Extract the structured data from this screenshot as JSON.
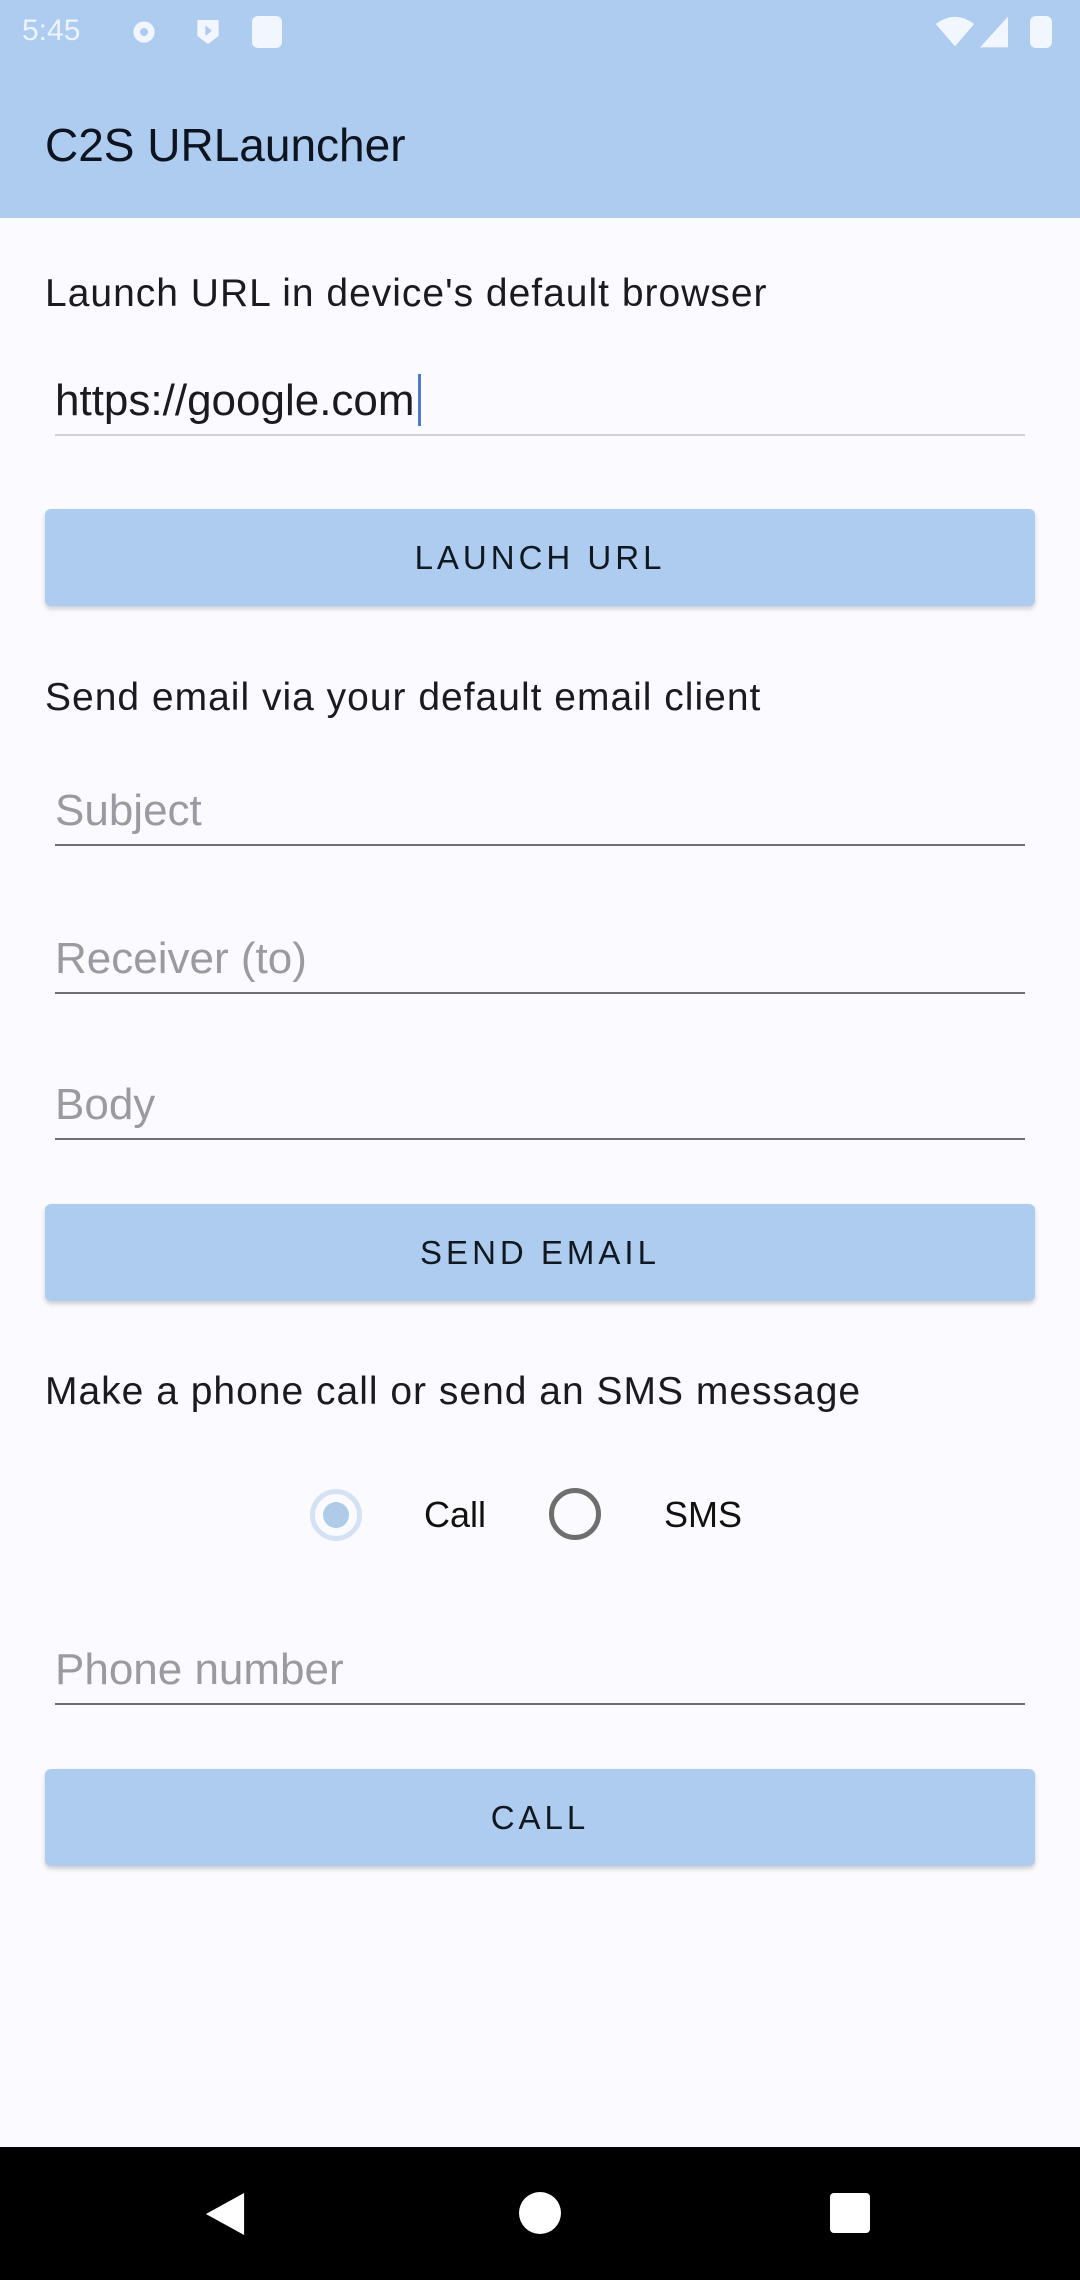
{
  "status_bar": {
    "time": "5:45",
    "icons": [
      "settings-icon",
      "play-icon",
      "sd-card-icon",
      "wifi-icon",
      "signal-icon",
      "battery-icon"
    ]
  },
  "app_bar": {
    "title": "C2S URLauncher"
  },
  "url_section": {
    "label": "Launch URL in device's default browser",
    "url_value": "https://google.com",
    "button": "LAUNCH URL"
  },
  "email_section": {
    "label": "Send email via your default email client",
    "subject_placeholder": "Subject",
    "receiver_placeholder": "Receiver (to)",
    "body_placeholder": "Body",
    "button": "SEND EMAIL"
  },
  "phone_section": {
    "label": "Make a phone call or send an SMS message",
    "options": [
      {
        "label": "Call",
        "selected": true
      },
      {
        "label": "SMS",
        "selected": false
      }
    ],
    "phone_placeholder": "Phone number",
    "button": "CALL"
  },
  "colors": {
    "primary": "#aecbf0",
    "background": "#fbfbff"
  }
}
